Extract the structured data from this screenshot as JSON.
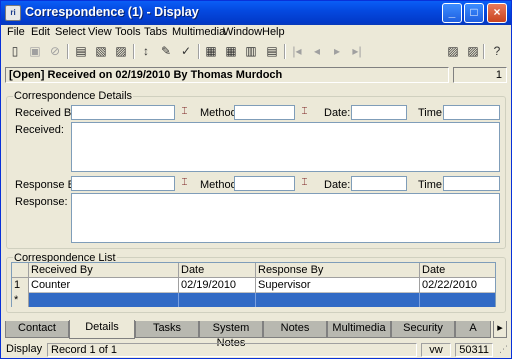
{
  "window": {
    "title": "Correspondence (1) - Display",
    "app_icon": "document-icon",
    "controls": {
      "minimize": "_",
      "maximize": "□",
      "close": "×"
    }
  },
  "menu": [
    "File",
    "Edit",
    "Select",
    "View",
    "Tools",
    "Tabs",
    "Multimedia",
    "Window",
    "Help"
  ],
  "record": {
    "header": "[Open] Received on 02/19/2010 By Thomas Murdoch",
    "count": "1"
  },
  "details": {
    "title": "Correspondence Details",
    "received_by_label": "Received By:",
    "method_label": "Method:",
    "date_label": "Date:",
    "time_label": "Time:",
    "received_label": "Received:",
    "response_by_label": "Response By:",
    "response_label": "Response:"
  },
  "list": {
    "title": "Correspondence List",
    "columns": [
      "Received By",
      "Date",
      "Response By",
      "Date"
    ],
    "rows": [
      {
        "num": "1",
        "received_by": "Counter",
        "date": "02/19/2010",
        "response_by": "Supervisor",
        "response_date": "02/22/2010"
      }
    ],
    "new_row_marker": "*"
  },
  "tabs": [
    "Contact",
    "Details",
    "Tasks",
    "System Notes",
    "Notes",
    "Multimedia",
    "Security",
    "A"
  ],
  "active_tab": "Details",
  "status": {
    "mode": "Display",
    "record": "Record 1 of 1",
    "vw": "vw",
    "code": "50311"
  },
  "colors": {
    "title_bar": "#0449e0",
    "selected_row": "#316ac5",
    "window_bg": "#ece9d8"
  }
}
